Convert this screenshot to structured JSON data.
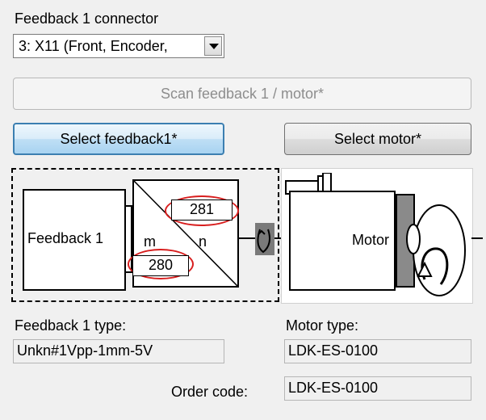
{
  "feedback_connector": {
    "label": "Feedback 1 connector",
    "selected": "3: X11 (Front, Encoder,"
  },
  "buttons": {
    "scan": "Scan feedback 1 / motor*",
    "select_feedback": "Select feedback1*",
    "select_motor": "Select motor*"
  },
  "diagram": {
    "feedback_label": "Feedback 1",
    "m_label": "m",
    "n_label": "n",
    "n_value": "281",
    "m_value": "280",
    "motor_label": "Motor",
    "highlight_color": "#d81e1e"
  },
  "feedback_type": {
    "label": "Feedback 1 type:",
    "value": "Unkn#1Vpp-1mm-5V"
  },
  "motor_type": {
    "label": "Motor type:",
    "value": "LDK-ES-0100"
  },
  "order_code": {
    "label": "Order code:",
    "value": "LDK-ES-0100"
  }
}
